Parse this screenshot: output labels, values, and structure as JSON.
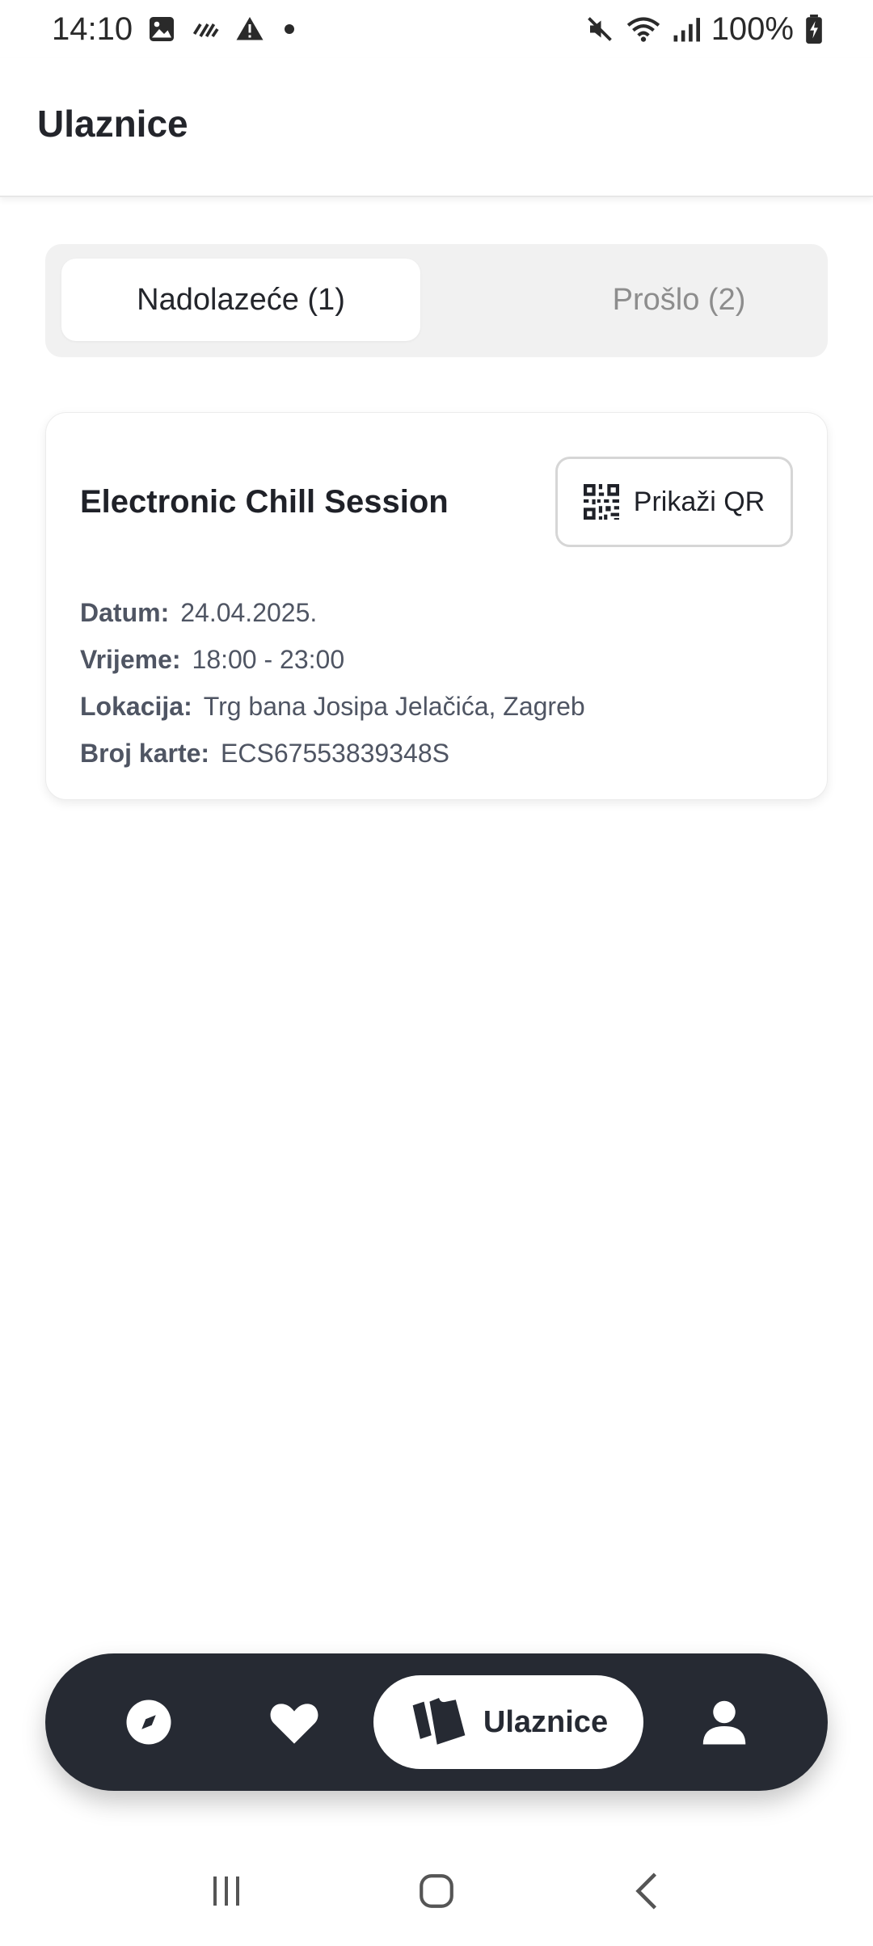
{
  "status_bar": {
    "time": "14:10",
    "battery": "100%",
    "left_icons": [
      "image-icon",
      "signal-strike-icon",
      "warning-icon",
      "dot-icon"
    ],
    "right_icons": [
      "mute-icon",
      "wifi-icon",
      "cell-signal-icon",
      "battery-charging-icon"
    ]
  },
  "header": {
    "title": "Ulaznice"
  },
  "tabs": [
    {
      "label": "Nadolazeće (1)",
      "active": true
    },
    {
      "label": "Prošlo (2)",
      "active": false
    }
  ],
  "ticket": {
    "title": "Electronic Chill Session",
    "qr_button_label": "Prikaži QR",
    "details": [
      {
        "label": "Datum:",
        "value": "24.04.2025."
      },
      {
        "label": "Vrijeme:",
        "value": "18:00 - 23:00"
      },
      {
        "label": "Lokacija:",
        "value": "Trg bana Josipa Jelačića, Zagreb"
      },
      {
        "label": "Broj karte:",
        "value": "ECS67553839348S"
      }
    ]
  },
  "bottom_nav": {
    "items": [
      {
        "icon": "compass-icon",
        "label": "",
        "active": false
      },
      {
        "icon": "heart-icon",
        "label": "",
        "active": false
      },
      {
        "icon": "tickets-icon",
        "label": "Ulaznice",
        "active": true
      },
      {
        "icon": "user-icon",
        "label": "",
        "active": false
      }
    ]
  },
  "system_nav": {
    "icons": [
      "recents-icon",
      "home-icon",
      "back-icon"
    ]
  },
  "colors": {
    "nav_background": "#262a33",
    "tab_background": "#f1f1f1",
    "label_text": "#4f5563",
    "inactive_tab_text": "#8d8d8d"
  }
}
